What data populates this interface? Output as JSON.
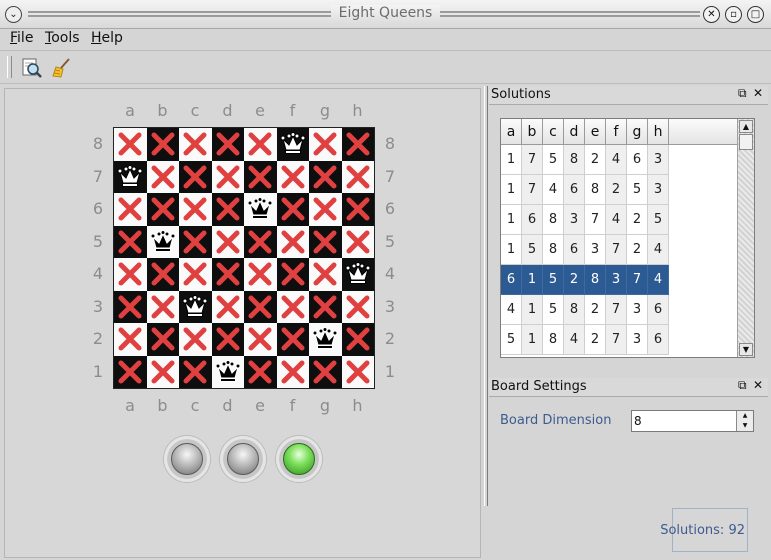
{
  "window": {
    "title": "Eight Queens"
  },
  "menu": [
    {
      "name": "File",
      "mn": "F",
      "rest": "ile"
    },
    {
      "name": "Tools",
      "mn": "T",
      "rest": "ools"
    },
    {
      "name": "Help",
      "mn": "H",
      "rest": "elp"
    }
  ],
  "toolbar": {
    "icons": [
      "find-icon",
      "broom-icon"
    ]
  },
  "board": {
    "columns": [
      "a",
      "b",
      "c",
      "d",
      "e",
      "f",
      "g",
      "h"
    ],
    "rows": [
      "8",
      "7",
      "6",
      "5",
      "4",
      "3",
      "2",
      "1"
    ],
    "queens": [
      "f8",
      "a7",
      "e6",
      "b5",
      "h4",
      "c3",
      "g2",
      "d1"
    ]
  },
  "lights": [
    "off",
    "off",
    "on"
  ],
  "docks": {
    "solutions": {
      "title": "Solutions"
    },
    "settings": {
      "title": "Board Settings"
    }
  },
  "solutions": {
    "headers": [
      "a",
      "b",
      "c",
      "d",
      "e",
      "f",
      "g",
      "h"
    ],
    "rows": [
      [
        "1",
        "7",
        "5",
        "8",
        "2",
        "4",
        "6",
        "3"
      ],
      [
        "1",
        "7",
        "4",
        "6",
        "8",
        "2",
        "5",
        "3"
      ],
      [
        "1",
        "6",
        "8",
        "3",
        "7",
        "4",
        "2",
        "5"
      ],
      [
        "1",
        "5",
        "8",
        "6",
        "3",
        "7",
        "2",
        "4"
      ],
      [
        "6",
        "1",
        "5",
        "2",
        "8",
        "3",
        "7",
        "4"
      ],
      [
        "4",
        "1",
        "5",
        "8",
        "2",
        "7",
        "3",
        "6"
      ],
      [
        "5",
        "1",
        "8",
        "4",
        "2",
        "7",
        "3",
        "6"
      ]
    ],
    "selected_index": 4
  },
  "settings": {
    "dimension_label": "Board Dimension",
    "dimension_value": "8"
  },
  "status": {
    "count_text": "Solutions: 92"
  },
  "colors": {
    "selection": "#2c5a92",
    "cross": "#e04040",
    "label_blue": "#3d5b8f",
    "light_on": "#5fd040"
  }
}
